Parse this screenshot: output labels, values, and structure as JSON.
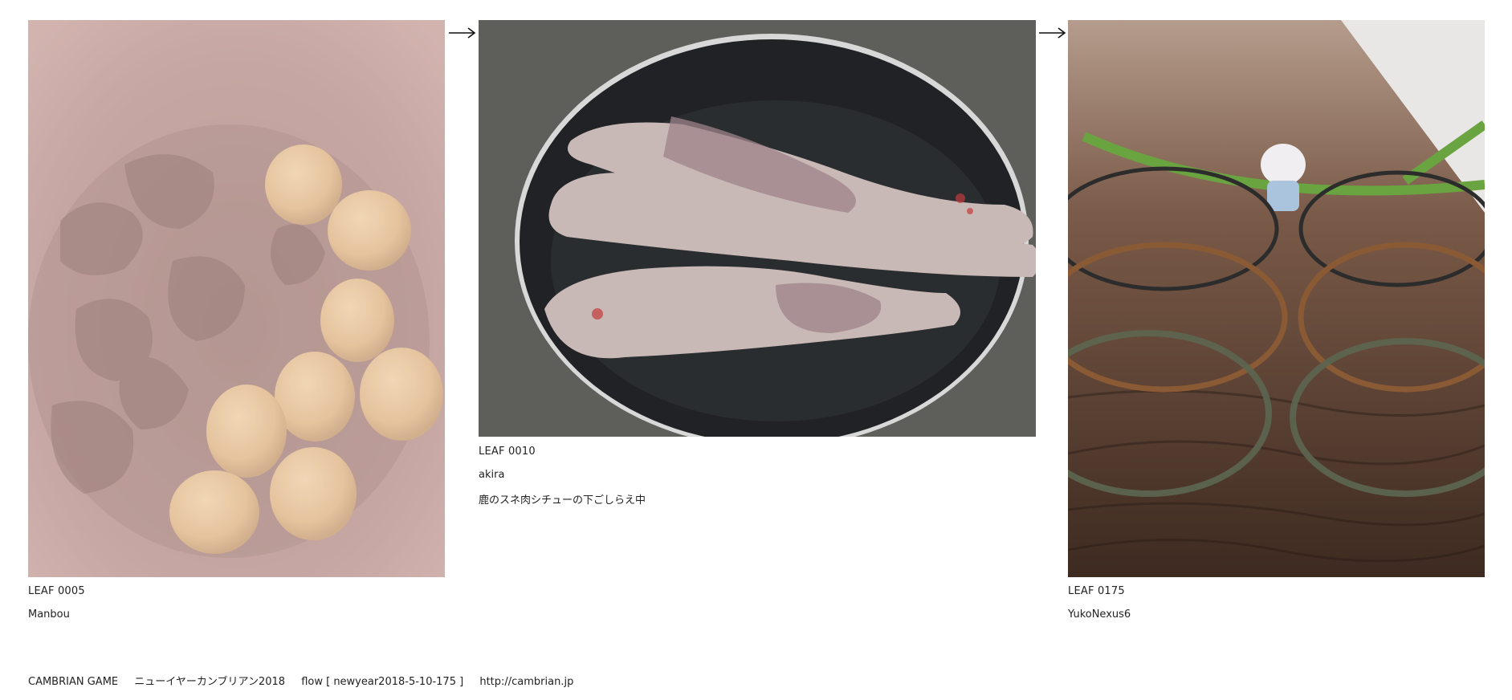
{
  "leaves": [
    {
      "id": "LEAF 0005",
      "author": "Manbou",
      "comment": ""
    },
    {
      "id": "LEAF 0010",
      "author": "akira",
      "comment": "鹿のスネ肉シチューの下ごしらえ中"
    },
    {
      "id": "LEAF 0175",
      "author": "YukoNexus6",
      "comment": ""
    }
  ],
  "arrows": [
    {
      "icon": "right-arrow-icon"
    },
    {
      "icon": "right-arrow-icon"
    }
  ],
  "footer": {
    "site": "CAMBRIAN GAME",
    "game": "ニューイヤーカンブリアン2018",
    "flow": "flow [ newyear2018-5-10-175 ]",
    "url": "http://cambrian.jp"
  }
}
